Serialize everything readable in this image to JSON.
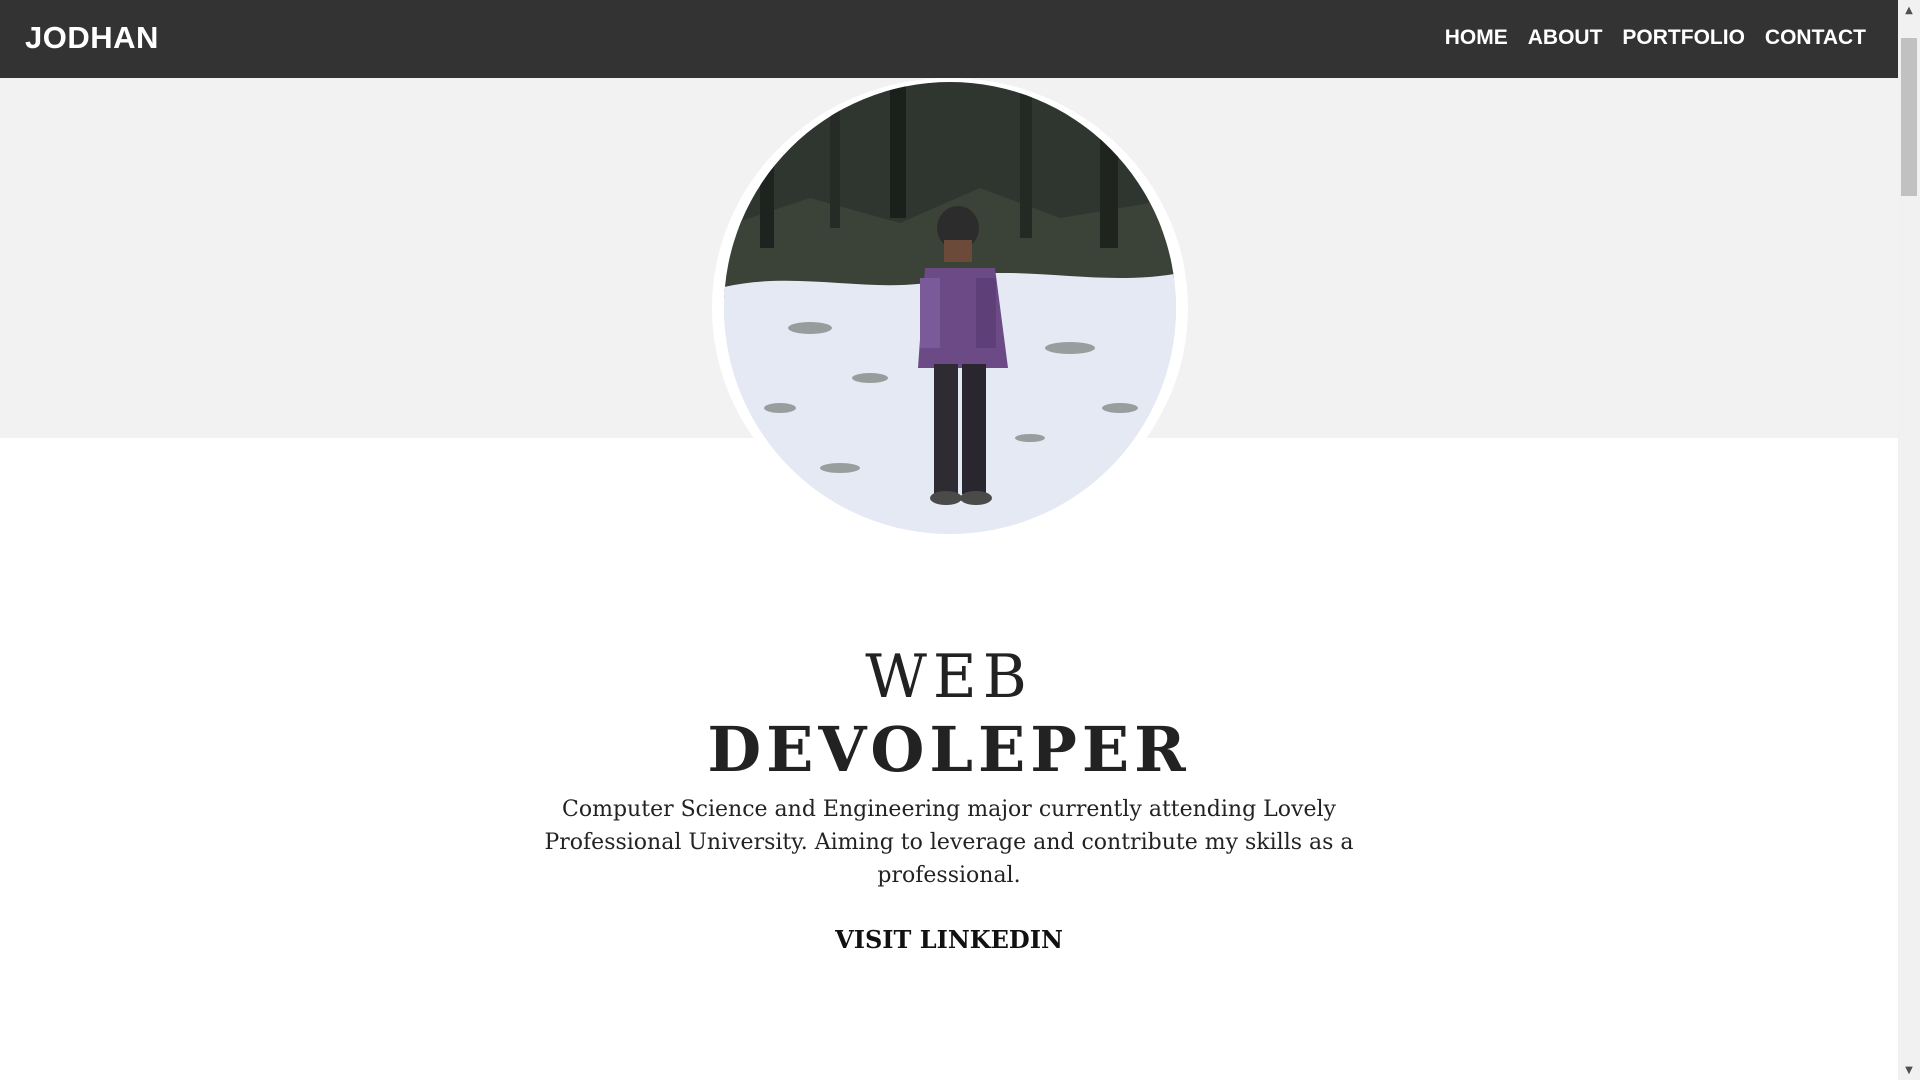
{
  "navbar": {
    "brand": "JODHAN",
    "items": [
      {
        "label": "HOME"
      },
      {
        "label": "ABOUT"
      },
      {
        "label": "PORTFOLIO"
      },
      {
        "label": "CONTACT"
      }
    ]
  },
  "hero": {
    "title_light": "WEB",
    "title_bold": "DEVOLEPER",
    "bio": "Computer Science and Engineering major currently attending Lovely Professional University. Aiming to leverage and contribute my skills as a professional.",
    "cta_label": "VISIT LINKEDIN"
  },
  "scrollbar": {
    "up_icon": "scroll-up-arrow-icon",
    "down_icon": "scroll-down-arrow-icon"
  },
  "colors": {
    "navbar_bg": "#333333",
    "hero_band_bg": "#f2f2f2",
    "text": "#222222"
  }
}
